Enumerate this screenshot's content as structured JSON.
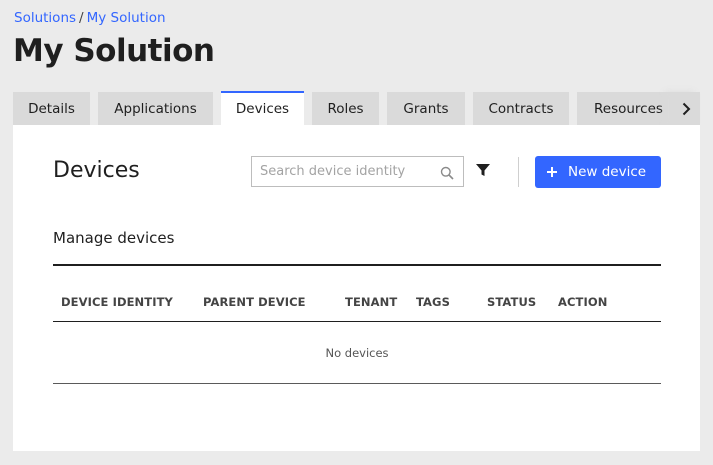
{
  "breadcrumb": {
    "root": "Solutions",
    "separator": "/",
    "current": "My Solution"
  },
  "page": {
    "title": "My Solution"
  },
  "tabs": [
    {
      "label": "Details",
      "active": false
    },
    {
      "label": "Applications",
      "active": false
    },
    {
      "label": "Devices",
      "active": true
    },
    {
      "label": "Roles",
      "active": false
    },
    {
      "label": "Grants",
      "active": false
    },
    {
      "label": "Contracts",
      "active": false
    },
    {
      "label": "Resources",
      "active": false
    }
  ],
  "devices": {
    "title": "Devices",
    "search": {
      "placeholder": "Search device identity",
      "value": "",
      "icon": "search-icon"
    },
    "filter_icon": "filter-icon",
    "new_button": {
      "label": "New device",
      "icon": "plus-icon"
    },
    "subtitle": "Manage devices",
    "table": {
      "columns": [
        "DEVICE IDENTITY",
        "PARENT DEVICE",
        "TENANT",
        "TAGS",
        "STATUS",
        "ACTION"
      ],
      "rows": [],
      "empty_text": "No devices"
    }
  },
  "colors": {
    "accent": "#3366ff",
    "background": "#ebebeb",
    "tab_inactive": "#dadada",
    "panel": "#ffffff"
  }
}
